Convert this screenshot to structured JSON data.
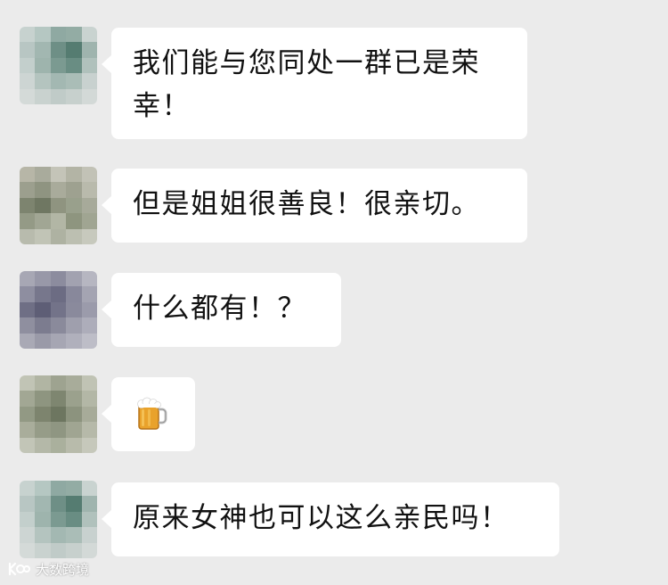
{
  "messages": [
    {
      "text": "我们能与您同处一群已是荣幸！",
      "avatar": [
        "#c7d2cf",
        "#b5c7c2",
        "#8fa9a2",
        "#93aca4",
        "#c9d3d0",
        "#b8c6c3",
        "#a2b7b1",
        "#6e8f86",
        "#557c71",
        "#9fb4ae",
        "#c3cfcc",
        "#9eb4ad",
        "#7b9a91",
        "#698d83",
        "#b0c1bc",
        "#cdd5d3",
        "#b4c4bf",
        "#a3b8b2",
        "#aabdb7",
        "#c8d1cf",
        "#d4dad8",
        "#c9d2cf",
        "#c0cbc8",
        "#c7d0cd",
        "#d3d9d7"
      ]
    },
    {
      "text": "但是姐姐很善良！很亲切。",
      "avatar": [
        "#b7b6a7",
        "#a9ab9c",
        "#c4c4b8",
        "#b3b4a5",
        "#c2c2b6",
        "#9c9f8e",
        "#8f9481",
        "#a9ab9b",
        "#9ea190",
        "#b9baac",
        "#7d846f",
        "#6f7762",
        "#8f9480",
        "#99a08c",
        "#a7aa9a",
        "#949a86",
        "#a1a694",
        "#b2b6a5",
        "#8e957f",
        "#a0a592",
        "#b8bbad",
        "#c1c4b6",
        "#aeb2a2",
        "#bcbfb1",
        "#c7c9bd"
      ]
    },
    {
      "text": "什么都有！？",
      "avatar": [
        "#a7a7b4",
        "#9898a8",
        "#8c8c9e",
        "#a2a2b0",
        "#b6b6c1",
        "#8e8ea0",
        "#77778c",
        "#6c6c83",
        "#88889b",
        "#a4a4b2",
        "#6f6f85",
        "#5e5e76",
        "#737389",
        "#8a8a9c",
        "#9b9bab",
        "#8f8f9f",
        "#7c7c8f",
        "#8a8a9b",
        "#9f9fad",
        "#adadba",
        "#a9a9b5",
        "#9a9aa8",
        "#a6a6b3",
        "#b0b0bc",
        "#bdbdc7"
      ]
    },
    {
      "emoji": "beer-mug",
      "avatar": [
        "#c1c4b5",
        "#b1b5a3",
        "#9ea390",
        "#a8ac9a",
        "#c0c3b4",
        "#a2a794",
        "#8e9580",
        "#7e8670",
        "#9ba18d",
        "#b3b7a6",
        "#929984",
        "#7d846e",
        "#6d7660",
        "#8c937e",
        "#a7ab99",
        "#a9ad9b",
        "#969c88",
        "#8f9682",
        "#a0a592",
        "#b6b9a9",
        "#c2c5b7",
        "#b4b8a8",
        "#aab09d",
        "#b8bbab",
        "#c6c8bb"
      ]
    },
    {
      "text": "原来女神也可以这么亲民吗！",
      "avatar": [
        "#c7d2cf",
        "#b5c7c2",
        "#8fa9a2",
        "#93aca4",
        "#c9d3d0",
        "#b8c6c3",
        "#a2b7b1",
        "#6e8f86",
        "#557c71",
        "#9fb4ae",
        "#c3cfcc",
        "#9eb4ad",
        "#7b9a91",
        "#698d83",
        "#b0c1bc",
        "#cdd5d3",
        "#b4c4bf",
        "#a3b8b2",
        "#aabdb7",
        "#c8d1cf",
        "#d4dad8",
        "#c9d2cf",
        "#c0cbc8",
        "#c7d0cd",
        "#d3d9d7"
      ]
    }
  ],
  "watermark": {
    "text": "大数跨境"
  },
  "colors": {
    "background": "#ebebeb",
    "bubble": "#ffffff",
    "text": "#111111"
  }
}
